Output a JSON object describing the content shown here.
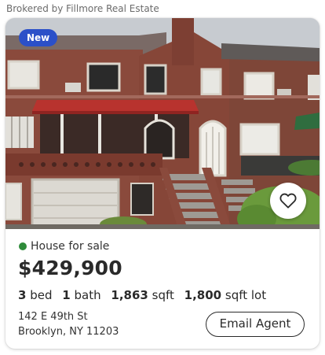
{
  "broker": {
    "text": "Brokered by Fillmore Real Estate"
  },
  "listing": {
    "badge": "New",
    "status": "House for sale",
    "price": "$429,900",
    "beds": {
      "value": "3",
      "unit": "bed"
    },
    "baths": {
      "value": "1",
      "unit": "bath"
    },
    "sqft": {
      "value": "1,863",
      "unit": "sqft"
    },
    "lot": {
      "value": "1,800",
      "unit": "sqft lot"
    },
    "address_line1": "142 E 49th St",
    "address_line2": "Brooklyn, NY 11203",
    "cta": "Email Agent",
    "favorite_icon": "heart-icon",
    "photo_subject": "brick-rowhouse-photo"
  },
  "colors": {
    "badge": "#2b50c8",
    "status_dot": "#2e8b3a",
    "text": "#2a2a2a",
    "awning": "#b8332e"
  }
}
